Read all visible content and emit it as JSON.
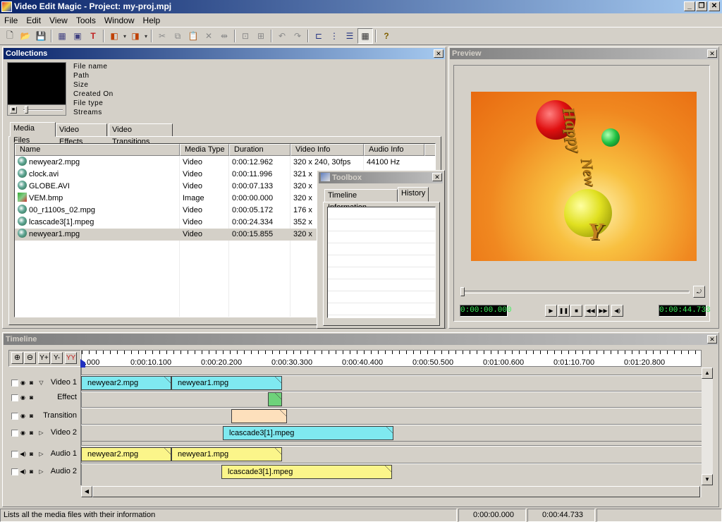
{
  "window": {
    "title": "Video Edit Magic - Project: my-proj.mpj"
  },
  "menu": [
    "File",
    "Edit",
    "View",
    "Tools",
    "Window",
    "Help"
  ],
  "collections": {
    "title": "Collections",
    "info_labels": [
      "File name",
      "Path",
      "Size",
      "Created On",
      "File type",
      "Streams"
    ],
    "tabs": [
      "Media Files",
      "Video Effects",
      "Video Transitions"
    ],
    "columns": [
      "Name",
      "Media Type",
      "Duration",
      "Video Info",
      "Audio Info"
    ],
    "rows": [
      {
        "name": "newyear2.mpg",
        "type": "Video",
        "duration": "0:00:12.962",
        "video": "320 x 240, 30fps",
        "audio": "44100 Hz",
        "icon": "video-file-icon"
      },
      {
        "name": "clock.avi",
        "type": "Video",
        "duration": "0:00:11.996",
        "video": "321 x",
        "audio": "",
        "icon": "video-file-icon"
      },
      {
        "name": "GLOBE.AVI",
        "type": "Video",
        "duration": "0:00:07.133",
        "video": "320 x",
        "audio": "",
        "icon": "video-file-icon"
      },
      {
        "name": "VEM.bmp",
        "type": "Image",
        "duration": "0:00:00.000",
        "video": "320 x",
        "audio": "",
        "icon": "image-file-icon"
      },
      {
        "name": "00_r1100s_02.mpg",
        "type": "Video",
        "duration": "0:00:05.172",
        "video": "176 x",
        "audio": "",
        "icon": "video-file-icon"
      },
      {
        "name": "lcascade3[1].mpeg",
        "type": "Video",
        "duration": "0:00:24.334",
        "video": "352 x",
        "audio": "",
        "icon": "video-file-icon"
      },
      {
        "name": "newyear1.mpg",
        "type": "Video",
        "duration": "0:00:15.855",
        "video": "320 x",
        "audio": "",
        "icon": "video-file-icon",
        "selected": true
      }
    ]
  },
  "toolbox": {
    "title": "Toolbox",
    "tabs": [
      "Timeline Information",
      "History"
    ]
  },
  "preview": {
    "title": "Preview",
    "current_time": "0:00:00.000",
    "total_time": "0:00:44.733",
    "overlay_text": [
      "Happy",
      "New",
      "Y"
    ]
  },
  "timeline": {
    "title": "Timeline",
    "ticks": [
      ".000",
      "0:00:10.100",
      "0:00:20.200",
      "0:00:30.300",
      "0:00:40.400",
      "0:00:50.500",
      "0:01:00.600",
      "0:01:10.700",
      "0:01:20.800"
    ],
    "tracks": [
      {
        "name": "Video 1",
        "clips": [
          "newyear2.mpg",
          "newyear1.mpg"
        ]
      },
      {
        "name": "Effect",
        "clips": [
          ""
        ]
      },
      {
        "name": "Transition",
        "clips": [
          ""
        ]
      },
      {
        "name": "Video 2",
        "clips": [
          "lcascade3[1].mpeg"
        ]
      },
      {
        "name": "Audio 1",
        "clips": [
          "newyear2.mpg",
          "newyear1.mpg"
        ]
      },
      {
        "name": "Audio 2",
        "clips": [
          "lcascade3[1].mpeg"
        ]
      }
    ]
  },
  "status": {
    "message": "Lists all the media files with their information",
    "current": "0:00:00.000",
    "total": "0:00:44.733"
  }
}
